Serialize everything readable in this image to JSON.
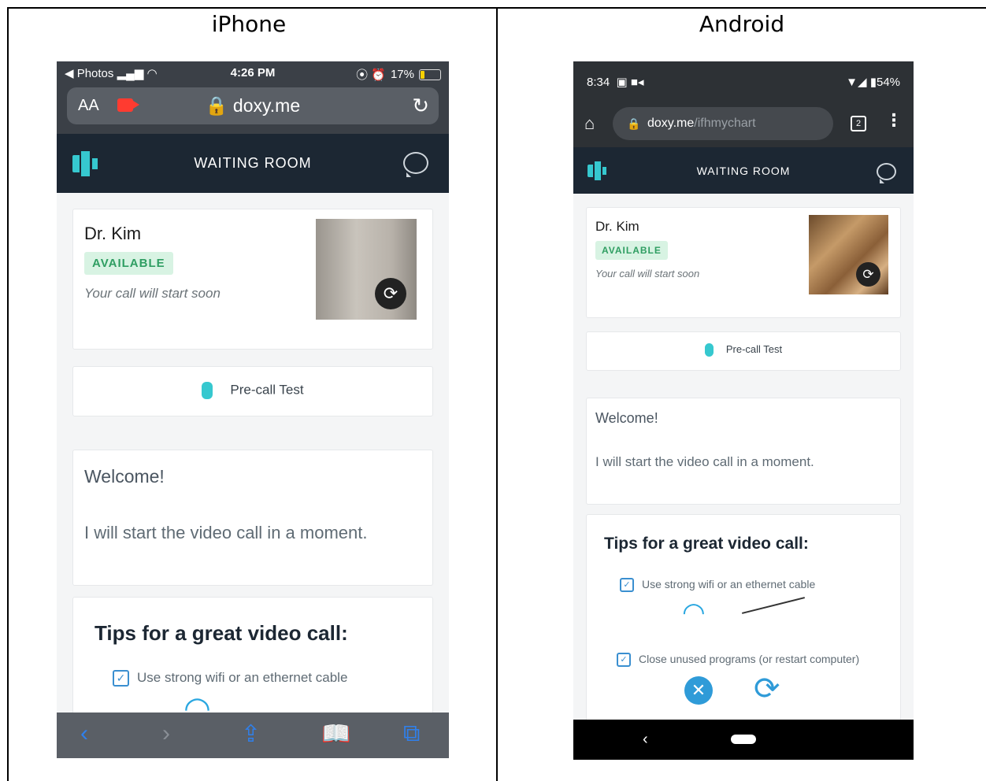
{
  "columns": {
    "left_title": "iPhone",
    "right_title": "Android"
  },
  "iphone": {
    "status": {
      "back_app": "◀ Photos",
      "signal": "▂▄▆",
      "wifi": "◠",
      "time": "4:26 PM",
      "icons": "⦿ ⏰",
      "battery": "17%"
    },
    "urlbar": {
      "text_size": "AA",
      "host": "🔒 doxy.me",
      "reload": "↻"
    },
    "nav": {
      "title": "WAITING ROOM"
    },
    "provider": {
      "name": "Dr. Kim",
      "status": "AVAILABLE",
      "message": "Your call will start soon"
    },
    "precall_label": "Pre-call Test",
    "greeting": {
      "title": "Welcome!",
      "message": "I will start the video call in a moment."
    },
    "tips": {
      "title": "Tips for a great video call:",
      "items": [
        "Use strong wifi or an ethernet cable"
      ]
    },
    "toolbar": {
      "back": "‹",
      "forward": "›",
      "share": "⇪",
      "bookmarks": "📖",
      "tabs": "⧉"
    }
  },
  "android": {
    "status": {
      "time": "8:34",
      "icons": "▣ ■◂",
      "right": "▼◢ ▮54%"
    },
    "urlbar": {
      "home": "⌂",
      "lock": "🔒",
      "host": "doxy.me",
      "path": "/ifhmychart",
      "tabs": "2",
      "more": "⋮"
    },
    "nav": {
      "title": "WAITING ROOM"
    },
    "provider": {
      "name": "Dr. Kim",
      "status": "AVAILABLE",
      "message": "Your call will start soon"
    },
    "precall_label": "Pre-call Test",
    "greeting": {
      "title": "Welcome!",
      "message": "I will start the video call in a moment."
    },
    "tips": {
      "title": "Tips for a great video call:",
      "items": [
        "Use strong wifi or an ethernet cable",
        "Close unused programs (or restart computer)"
      ]
    },
    "navbar": {
      "back": "‹"
    }
  },
  "colors": {
    "accent": "#36c8cf",
    "navbar": "#1c2733",
    "available_bg": "#d8f3e3",
    "available_text": "#2f9e62",
    "check": "#3a8fd0"
  }
}
